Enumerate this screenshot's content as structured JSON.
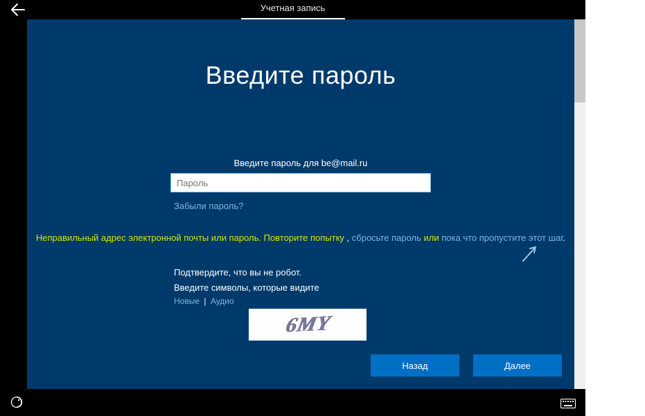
{
  "header": {
    "tab_label": "Учетная запись"
  },
  "main": {
    "heading": "Введите пароль",
    "prompt": "Введите пароль для be@mail.ru",
    "password_placeholder": "Пароль",
    "password_value": "",
    "forgot_label": "Забыли пароль?"
  },
  "error": {
    "part1": "Неправильный адрес электронной почты или пароль. Повторите попытку",
    "comma": " , ",
    "reset_link": "сбросьте пароль",
    "or": " или ",
    "skip_link": "пока что пропустите этот шаг",
    "dot": "."
  },
  "captcha": {
    "confirm_label": "Подтвердите, что вы не робот.",
    "instruction": "Введите символы, которые видите",
    "new_label": "Новые",
    "audio_label": "Аудио",
    "separator": "|",
    "image_text": "6MY"
  },
  "footer": {
    "back_label": "Назад",
    "next_label": "Далее"
  }
}
